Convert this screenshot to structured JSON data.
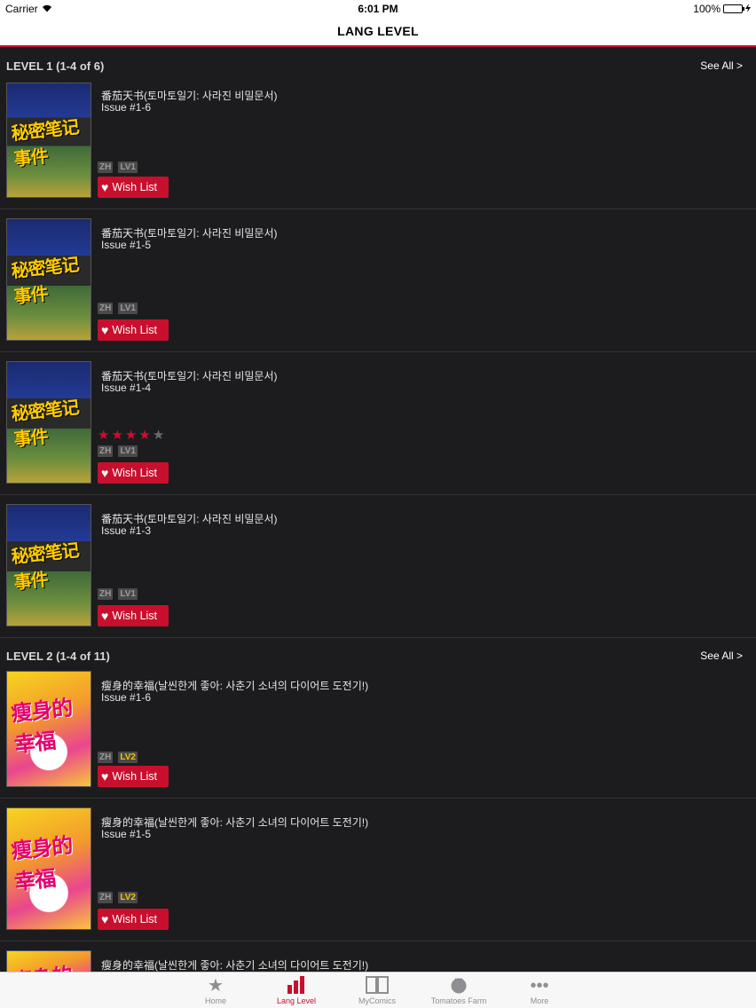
{
  "status_bar": {
    "carrier": "Carrier",
    "time": "6:01 PM",
    "battery": "100%"
  },
  "nav": {
    "title": "LANG LEVEL"
  },
  "sections": [
    {
      "title": "LEVEL 1 (1-4 of 6)",
      "see_all": "See All >",
      "items": [
        {
          "title": "番茄天书(토마토일기: 사라진 비밀문서)",
          "issue": "Issue #1-6",
          "lang_tag": "ZH",
          "level_tag": "LV1",
          "wish_label": "Wish List"
        },
        {
          "title": "番茄天书(토마토일기: 사라진 비밀문서)",
          "issue": "Issue #1-5",
          "lang_tag": "ZH",
          "level_tag": "LV1",
          "wish_label": "Wish List"
        },
        {
          "title": "番茄天书(토마토일기: 사라진 비밀문서)",
          "issue": "Issue #1-4",
          "lang_tag": "ZH",
          "level_tag": "LV1",
          "wish_label": "Wish List",
          "rating": 4,
          "rating_max": 5
        },
        {
          "title": "番茄天书(토마토일기: 사라진 비밀문서)",
          "issue": "Issue #1-3",
          "lang_tag": "ZH",
          "level_tag": "LV1",
          "wish_label": "Wish List"
        }
      ]
    },
    {
      "title": "LEVEL 2 (1-4 of 11)",
      "see_all": "See All >",
      "items": [
        {
          "title": "瘦身的幸福(날씬한게 좋아: 사춘기 소녀의 다이어트 도전기!)",
          "issue": "Issue #1-6",
          "lang_tag": "ZH",
          "level_tag": "LV2",
          "wish_label": "Wish List"
        },
        {
          "title": "瘦身的幸福(날씬한게 좋아: 사춘기 소녀의 다이어트 도전기!)",
          "issue": "Issue #1-5",
          "lang_tag": "ZH",
          "level_tag": "LV2",
          "wish_label": "Wish List"
        },
        {
          "title": "瘦身的幸福(날씬한게 좋아: 사춘기 소녀의 다이어트 도전기!)"
        }
      ]
    }
  ],
  "tabs": [
    {
      "label": "Home",
      "icon": "star-icon",
      "active": false
    },
    {
      "label": "Lang Level",
      "icon": "bar-chart-icon",
      "active": true
    },
    {
      "label": "MyComics",
      "icon": "book-icon",
      "active": false
    },
    {
      "label": "Tomatoes Farm",
      "icon": "tomato-icon",
      "active": false
    },
    {
      "label": "More",
      "icon": "more-icon",
      "active": false
    }
  ],
  "colors": {
    "accent": "#c8102e",
    "background": "#1c1c1e",
    "level2_tag": "#f2c200"
  }
}
